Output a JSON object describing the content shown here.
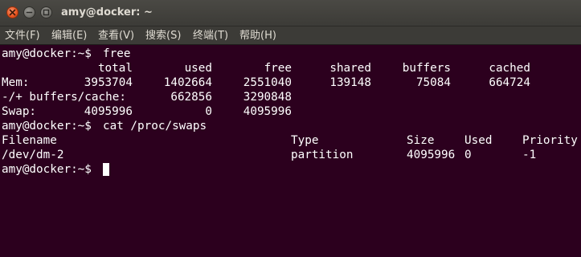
{
  "window": {
    "title": "amy@docker: ~"
  },
  "menu": {
    "items": [
      "文件(F)",
      "编辑(E)",
      "查看(V)",
      "搜索(S)",
      "终端(T)",
      "帮助(H)"
    ]
  },
  "terminal": {
    "prompt": "amy@docker:~$",
    "command_1": "free",
    "free_header": [
      "total",
      "used",
      "free",
      "shared",
      "buffers",
      "cached"
    ],
    "mem_row": [
      "Mem:",
      "3953704",
      "1402664",
      "2551040",
      "139148",
      "75084",
      "664724"
    ],
    "buffers_row": [
      "-/+ buffers/cache:",
      "662856",
      "3290848"
    ],
    "swap_row": [
      "Swap:",
      "4095996",
      "0",
      "4095996"
    ],
    "command_2": "cat /proc/swaps",
    "swaps_header": [
      "Filename",
      "Type",
      "Size",
      "Used",
      "Priority"
    ],
    "swaps_row": [
      "/dev/dm-2",
      "partition",
      "4095996",
      "0",
      "-1"
    ]
  },
  "colors": {
    "terminal_bg": "#2c001e",
    "text": "#ffffff",
    "titlebar": "#3c3b37",
    "close_button": "#e95420"
  }
}
